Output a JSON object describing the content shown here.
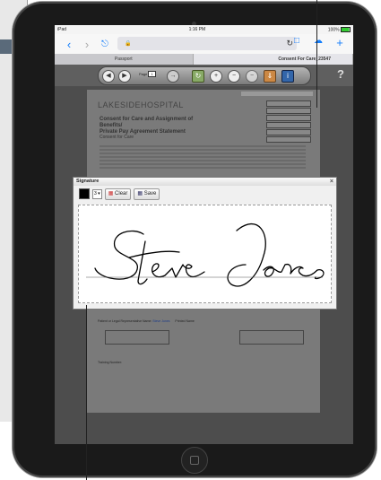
{
  "status_bar": {
    "device": "iPad",
    "time": "1:16 PM",
    "battery": "100%"
  },
  "browser": {
    "tabs": [
      {
        "label": "Passport"
      },
      {
        "label": "Consent For Care_23547"
      }
    ],
    "active_tab_title": "Consent For Care_23547"
  },
  "toolbar": {
    "page_label": "Page",
    "page_value": "1",
    "help_label": "?"
  },
  "document": {
    "logo_text": "LAKESIDEHOSPITAL",
    "title_line1": "Consent for Care and Assignment of Benefits/",
    "title_line2": "Private Pay Agreement Statement",
    "section_label": "Consent for Care",
    "lower_text": "I have read and intend to consent for all the content.",
    "patient_label": "Patient or Legal Representative Name",
    "patient_value": "Steve Jones",
    "date_label": "Printed Name",
    "training_label": "Training Number:"
  },
  "signature_dialog": {
    "title": "Signature",
    "pen_size": "3",
    "clear_label": "Clear",
    "save_label": "Save",
    "signature_name": "Steve Jones"
  },
  "colors": {
    "accent": "#147efb",
    "toolbar": "#5f5f5f",
    "doc_bg": "#4d4d4d"
  }
}
